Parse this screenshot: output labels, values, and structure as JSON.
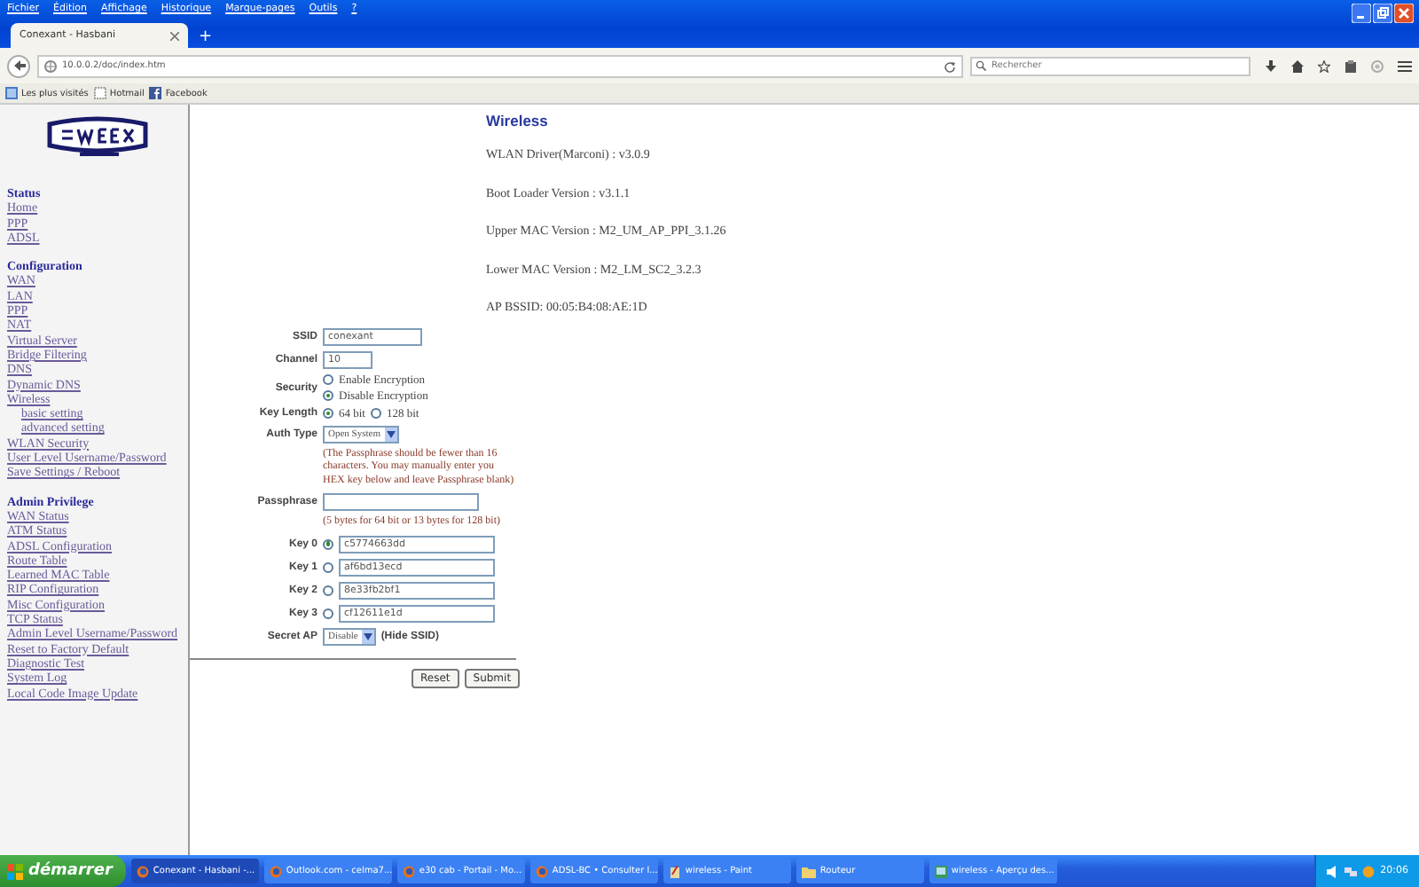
{
  "menu": [
    "Fichier",
    "Édition",
    "Affichage",
    "Historique",
    "Marque-pages",
    "Outils",
    "?"
  ],
  "tabs": [
    {
      "label": "Conexant - Hasbani",
      "selected": true
    }
  ],
  "new_tab": "+",
  "address": "10.0.0.2/doc/index.htm",
  "search": {
    "placeholder": "Rechercher"
  },
  "bookmarks": [
    {
      "label": "Les plus visités",
      "kind": "folder"
    },
    {
      "label": "Hotmail",
      "kind": "page"
    },
    {
      "label": "Facebook",
      "kind": "facebook"
    }
  ],
  "sidebar": [
    {
      "title": "Status",
      "items": [
        {
          "label": "Home"
        },
        {
          "label": "PPP"
        },
        {
          "label": "ADSL"
        }
      ]
    },
    {
      "title": "Configuration",
      "items": [
        {
          "label": "WAN"
        },
        {
          "label": "LAN"
        },
        {
          "label": "PPP"
        },
        {
          "label": "NAT"
        },
        {
          "label": "Virtual Server"
        },
        {
          "label": "Bridge Filtering"
        },
        {
          "label": "DNS"
        },
        {
          "label": "Dynamic DNS"
        },
        {
          "label": "Wireless",
          "children": [
            {
              "label": "basic setting"
            },
            {
              "label": "advanced setting"
            }
          ]
        },
        {
          "label": "WLAN Security"
        },
        {
          "label": "User Level Username/Password"
        },
        {
          "label": "Save Settings / Reboot"
        }
      ]
    },
    {
      "title": "Admin Privilege",
      "items": [
        {
          "label": "WAN Status"
        },
        {
          "label": "ATM Status"
        },
        {
          "label": "ADSL Configuration"
        },
        {
          "label": "Route Table"
        },
        {
          "label": "Learned MAC Table"
        },
        {
          "label": "RIP Configuration"
        },
        {
          "label": "Misc Configuration"
        },
        {
          "label": "TCP Status"
        },
        {
          "label": "Admin Level Username/Password"
        },
        {
          "label": "Reset to Factory Default"
        },
        {
          "label": "Diagnostic Test"
        },
        {
          "label": "System Log"
        },
        {
          "label": "Local Code Image Update"
        }
      ]
    }
  ],
  "main": {
    "title": "Wireless",
    "info": [
      "WLAN Driver(Marconi) : v3.0.9",
      "Boot Loader Version : v3.1.1",
      "Upper MAC Version : M2_UM_AP_PPI_3.1.26",
      "Lower MAC Version : M2_LM_SC2_3.2.3",
      "AP BSSID: 00:05:B4:08:AE:1D"
    ],
    "form": [
      {
        "kind": "text",
        "label": "SSID",
        "value": "conexant"
      },
      {
        "kind": "short-text",
        "label": "Channel",
        "value": "10"
      },
      {
        "kind": "radio-list",
        "label": "Security",
        "options": [
          {
            "label": "Enable Encryption",
            "selected": false
          },
          {
            "label": "Disable Encryption",
            "selected": true
          }
        ]
      },
      {
        "kind": "radio-inline",
        "label": "Key Length",
        "options": [
          {
            "label": "64 bit",
            "selected": true
          },
          {
            "label": "128 bit",
            "selected": false
          }
        ]
      },
      {
        "kind": "select",
        "label": "Auth Type",
        "value": "Open System"
      },
      {
        "kind": "note",
        "text": "(The Passphrase should be fewer than 16 characters. You may manually enter you HEX key below and leave Passphrase blank)"
      },
      {
        "kind": "wide-text",
        "label": "Passphrase"
      },
      {
        "kind": "note",
        "text": "(5 bytes for 64 bit or 13 bytes for 128 bit)"
      },
      {
        "kind": "key",
        "label": "Key 0",
        "selected": true,
        "value": "c5774663dd"
      },
      {
        "kind": "key",
        "label": "Key 1",
        "selected": false,
        "value": "af6bd13ecd"
      },
      {
        "kind": "key",
        "label": "Key 2",
        "selected": false,
        "value": "8e33fb2bf1"
      },
      {
        "kind": "key",
        "label": "Key 3",
        "selected": false,
        "value": "cf12611e1d"
      },
      {
        "kind": "select",
        "label": "Secret AP",
        "value": "Disable",
        "suffix": "(Hide SSID)"
      }
    ],
    "buttons": [
      "Reset",
      "Submit"
    ]
  },
  "taskbar": {
    "start": "démarrer",
    "tasks": [
      {
        "label": "Conexant - Hasbani -...",
        "kind": "browser",
        "selected": true
      },
      {
        "label": "Outlook.com - celma7...",
        "kind": "browser",
        "selected": false
      },
      {
        "label": "e30 cab - Portail - Mo...",
        "kind": "browser",
        "selected": false
      },
      {
        "label": "ADSL-BC • Consulter l...",
        "kind": "browser",
        "selected": false
      },
      {
        "label": "wireless - Paint",
        "kind": "paint",
        "selected": false
      },
      {
        "label": "Routeur",
        "kind": "folder",
        "selected": false
      },
      {
        "label": "wireless - Aperçu des...",
        "kind": "viewer",
        "selected": false
      }
    ],
    "clock": "20:06"
  }
}
